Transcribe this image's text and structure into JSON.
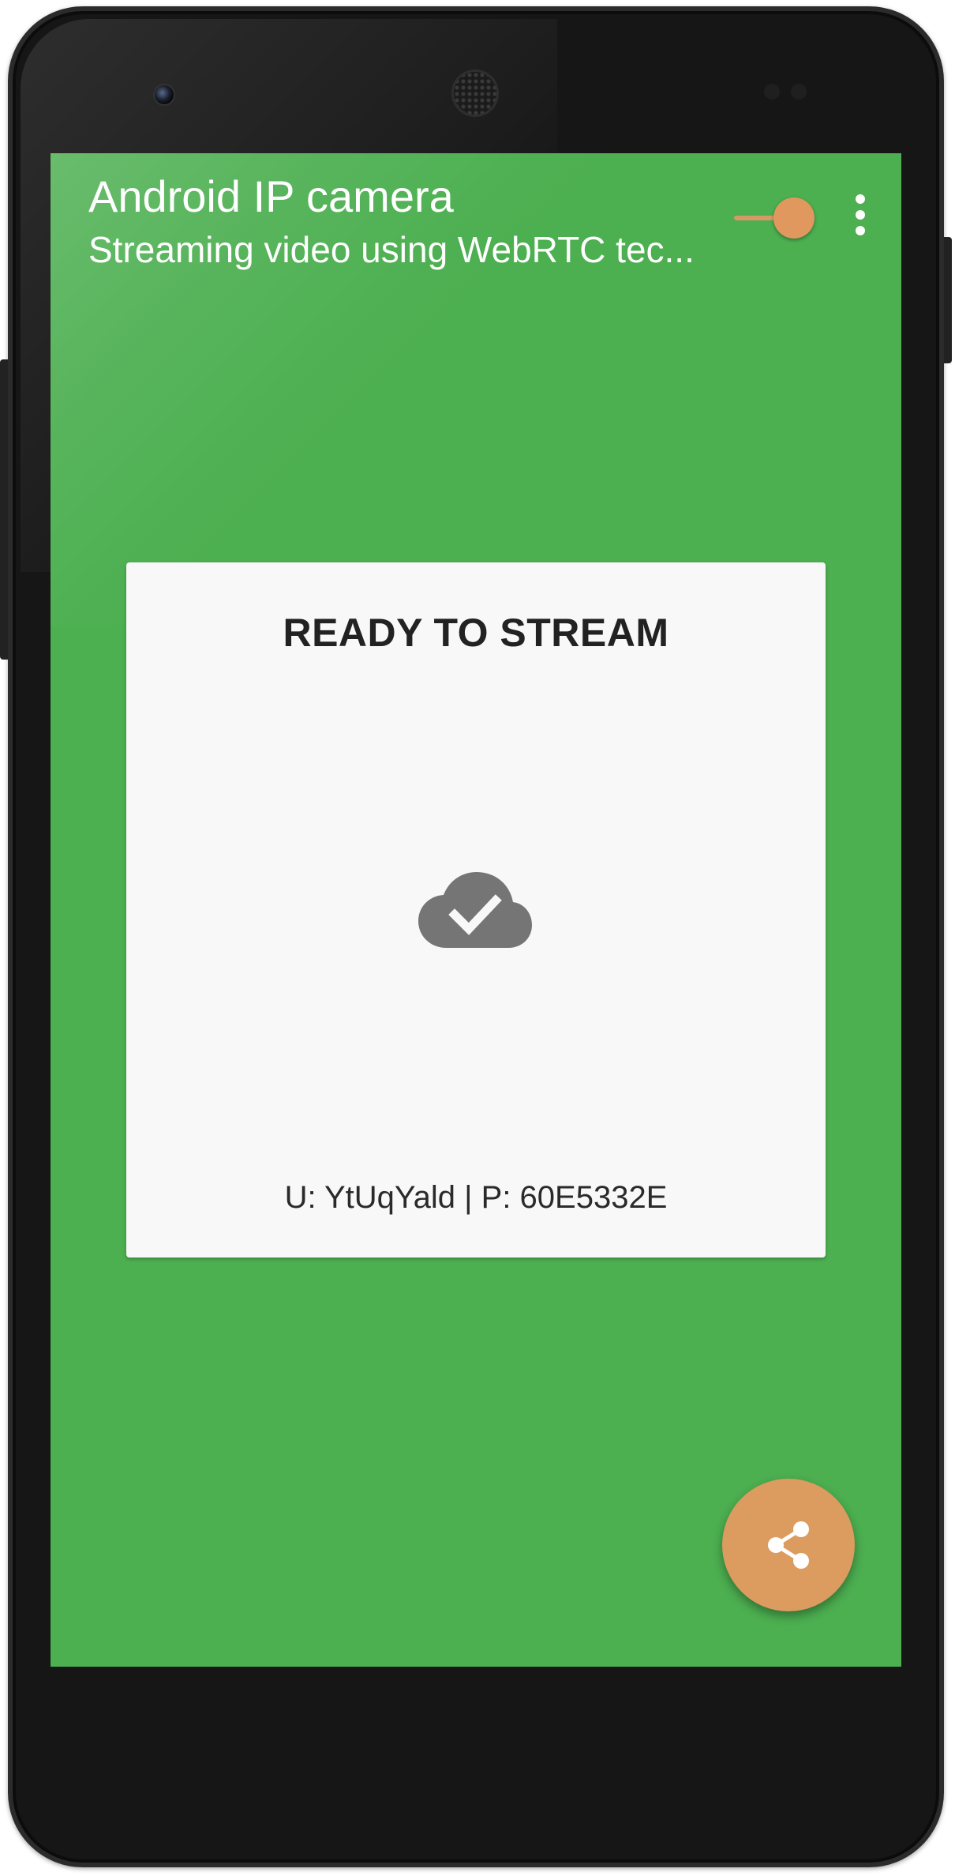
{
  "app_bar": {
    "title": "Android IP camera",
    "subtitle": "Streaming video using WebRTC tec..."
  },
  "controls": {
    "stream_switch_on": true,
    "overflow_menu_icon": "more-vert-icon"
  },
  "status_card": {
    "title": "READY TO STREAM",
    "status_icon": "cloud-done-icon",
    "credentials": "U: YtUqYald | P: 60E5332E"
  },
  "fab": {
    "icon": "share-icon"
  },
  "colors": {
    "primary": "#4caf50",
    "accent": "#dc9b5f",
    "card_background": "#f8f8f8",
    "icon_gray": "#757575"
  }
}
